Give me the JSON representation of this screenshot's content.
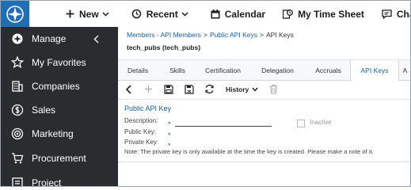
{
  "topbar": {
    "items": [
      {
        "label": "New",
        "icon": "plus-icon"
      },
      {
        "label": "Recent",
        "icon": "history-icon"
      },
      {
        "label": "Calendar",
        "icon": "calendar-icon"
      },
      {
        "label": "My Time Sheet",
        "icon": "timesheet-icon"
      },
      {
        "label": "Chat with S",
        "icon": "chat-icon"
      }
    ]
  },
  "sidebar": {
    "items": [
      {
        "label": "Manage",
        "icon": "gear-icon"
      },
      {
        "label": "My Favorites",
        "icon": "star-icon"
      },
      {
        "label": "Companies",
        "icon": "building-icon"
      },
      {
        "label": "Sales",
        "icon": "dollar-icon"
      },
      {
        "label": "Marketing",
        "icon": "target-icon"
      },
      {
        "label": "Procurement",
        "icon": "cart-icon"
      },
      {
        "label": "Project",
        "icon": "project-icon"
      }
    ]
  },
  "breadcrumb": {
    "items": [
      "Members - API Members",
      "Public API Keys",
      "API Keys"
    ],
    "separator": ">"
  },
  "subtitle": "tech_pubs (tech_pubs)",
  "tabs": [
    "Details",
    "Skills",
    "Certification",
    "Delegation",
    "Accruals",
    "API Keys",
    "A"
  ],
  "active_tab": "API Keys",
  "toolbar": {
    "history_label": "History"
  },
  "panel": {
    "title": "Public API Key",
    "description_label": "Description:",
    "description_value": "",
    "inactive_label": "Inactive",
    "public_key_label": "Public Key:",
    "private_key_label": "Private Key:",
    "required_marker": "*",
    "note": "Note: The private key is only available at the time the key is created. Please make a note of it."
  },
  "colors": {
    "brand_blue": "#1f6fb8",
    "sidebar_bg": "#2a2d30",
    "link": "#1a5fa8"
  }
}
